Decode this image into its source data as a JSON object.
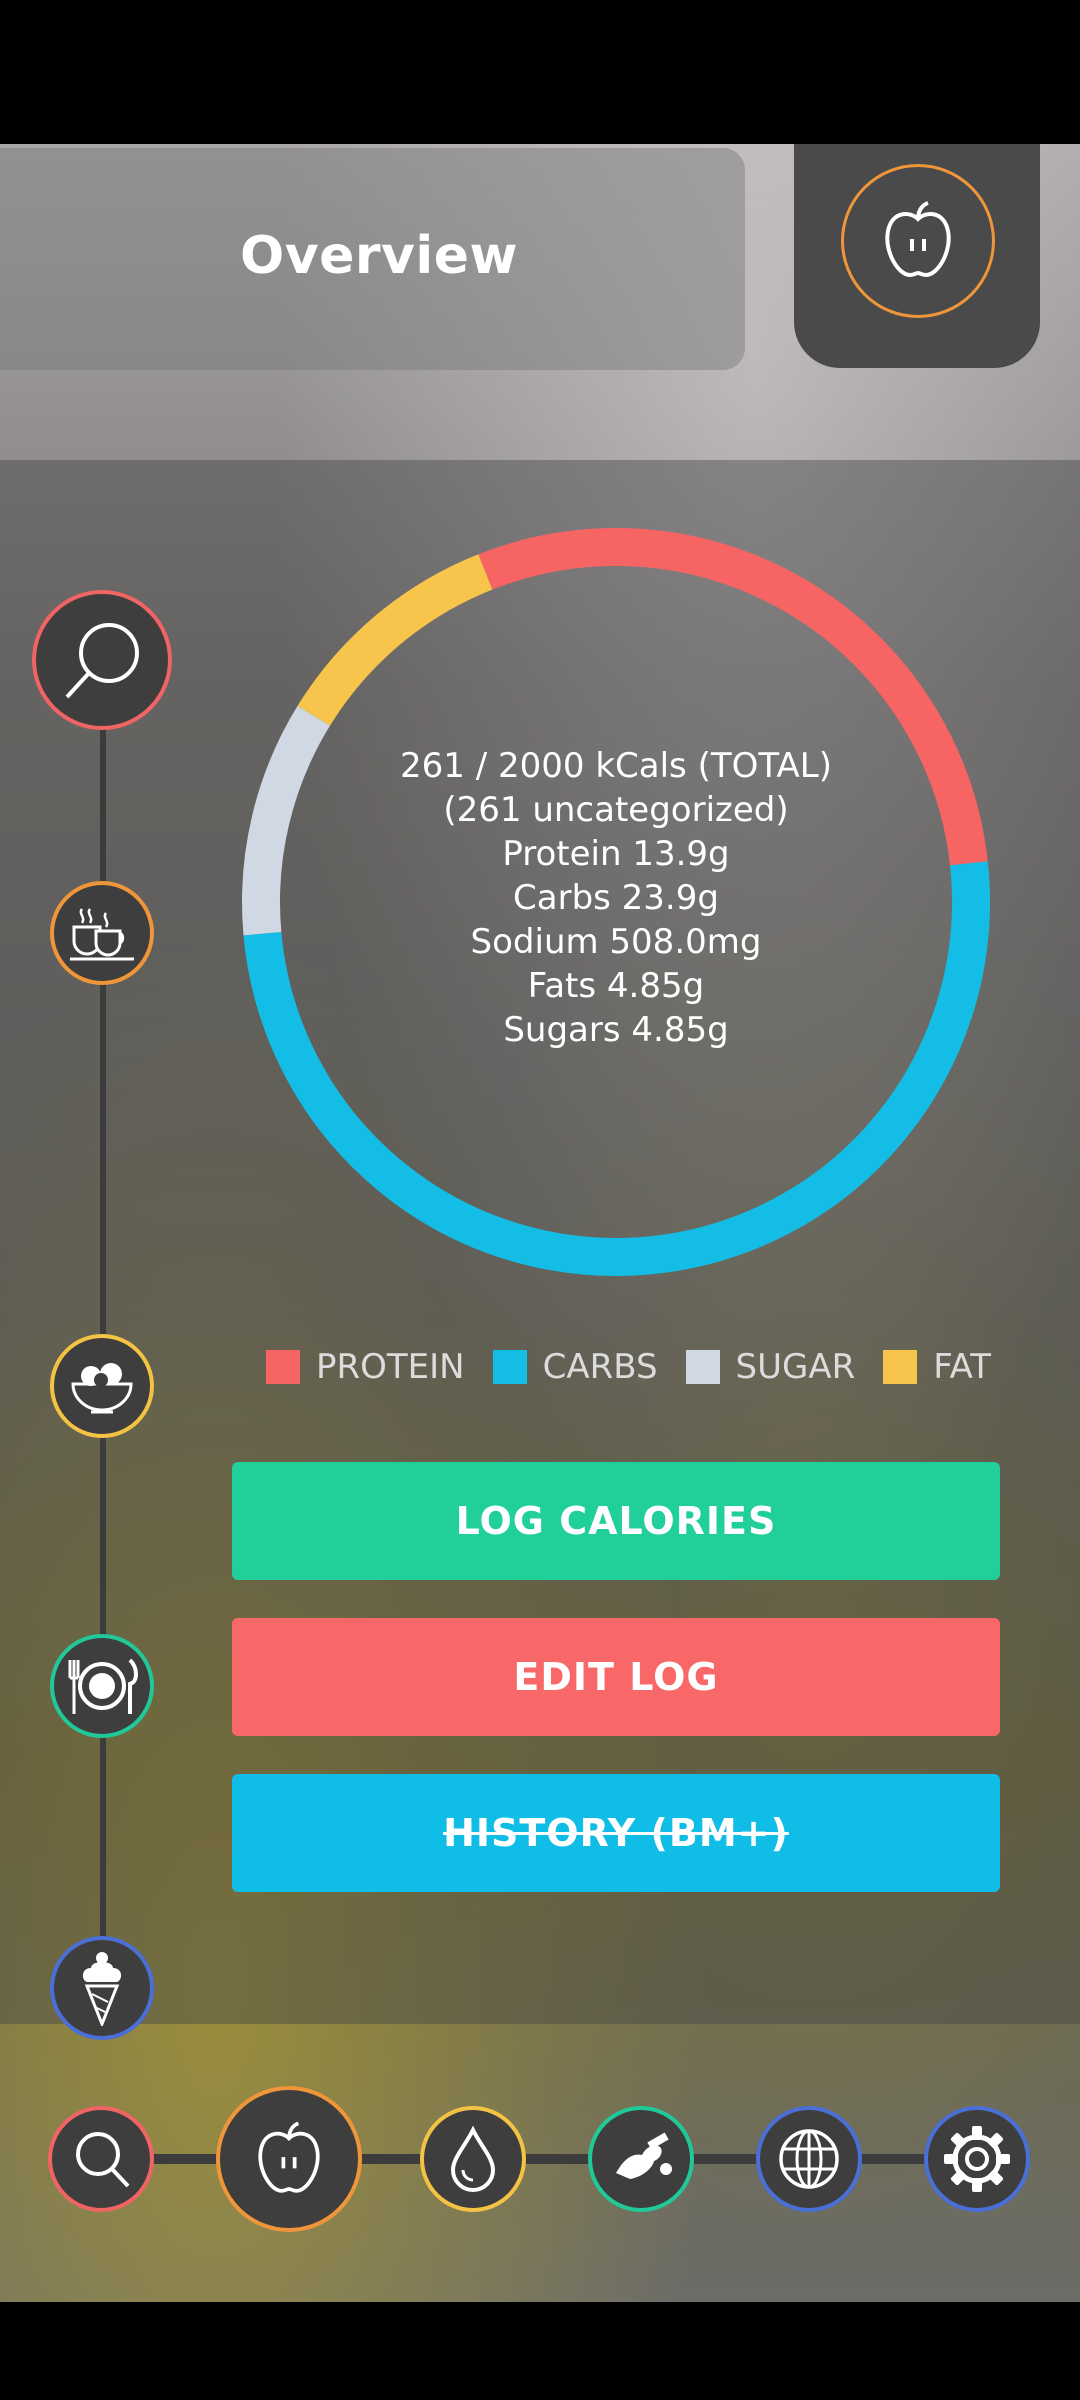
{
  "header": {
    "title": "Overview",
    "apple_icon": "apple-icon"
  },
  "side_rail": [
    {
      "name": "search",
      "icon": "search-icon",
      "color": "#f06464"
    },
    {
      "name": "drinks",
      "icon": "coffee-cups-icon",
      "color": "#f0963a"
    },
    {
      "name": "salad",
      "icon": "salad-bowl-icon",
      "color": "#f5c344"
    },
    {
      "name": "meal",
      "icon": "plate-cutlery-icon",
      "color": "#21c99a"
    },
    {
      "name": "dessert",
      "icon": "ice-cream-icon",
      "color": "#4a6fd6"
    }
  ],
  "summary": {
    "total_line": "261 / 2000 kCals (TOTAL)",
    "uncategorized_line": "(261 uncategorized)",
    "protein_line": "Protein 13.9g",
    "carbs_line": "Carbs 23.9g",
    "sodium_line": "Sodium 508.0mg",
    "fats_line": "Fats 4.85g",
    "sugars_line": "Sugars 4.85g"
  },
  "chart_data": {
    "type": "pie",
    "donut": true,
    "categories": [
      "PROTEIN",
      "CARBS",
      "SUGAR",
      "FAT"
    ],
    "values": [
      13.9,
      23.9,
      4.85,
      4.85
    ],
    "colors": [
      "#f76464",
      "#14bde6",
      "#cfd8e3",
      "#f7c44c"
    ],
    "legend_position": "bottom"
  },
  "legend": [
    {
      "label": "PROTEIN",
      "color": "#f76464"
    },
    {
      "label": "CARBS",
      "color": "#14bde6"
    },
    {
      "label": "SUGAR",
      "color": "#cfd8e3"
    },
    {
      "label": "FAT",
      "color": "#f7c44c"
    }
  ],
  "actions": {
    "log_calories": {
      "label": "LOG CALORIES",
      "color": "#21cf9b"
    },
    "edit_log": {
      "label": "EDIT LOG",
      "color": "#f96868"
    },
    "history": {
      "label": "HISTORY (BM+)",
      "color": "#0fbde6"
    }
  },
  "bottom_nav": [
    {
      "name": "search",
      "icon": "search-icon",
      "color": "#f06464"
    },
    {
      "name": "food",
      "icon": "apple-icon",
      "color": "#f0963a",
      "active": true
    },
    {
      "name": "water",
      "icon": "water-drop-icon",
      "color": "#f5c344"
    },
    {
      "name": "exercise",
      "icon": "dumbbell-arm-icon",
      "color": "#21c99a"
    },
    {
      "name": "web",
      "icon": "globe-icon",
      "color": "#4a6fd6"
    },
    {
      "name": "settings",
      "icon": "gear-icon",
      "color": "#4a6fd6"
    }
  ]
}
